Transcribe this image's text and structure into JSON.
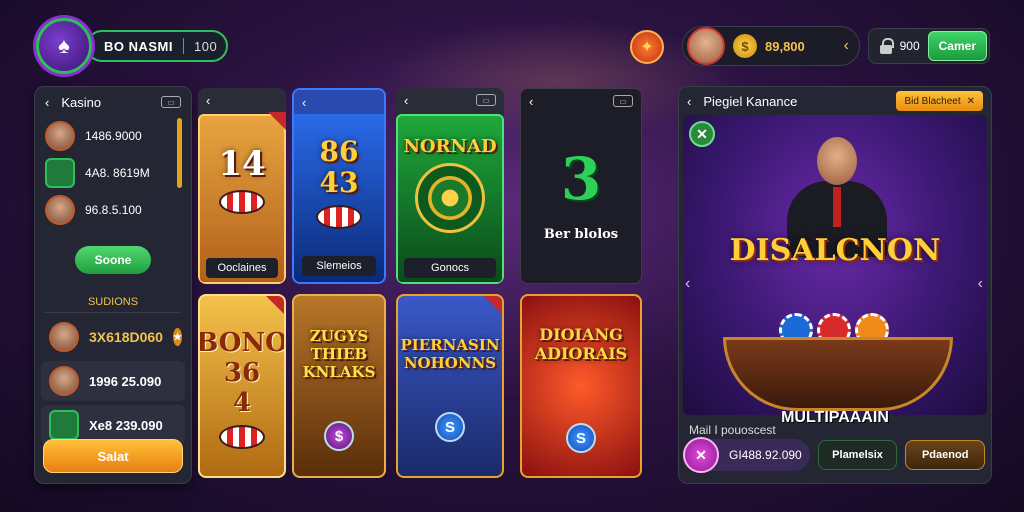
{
  "colors": {
    "accent_green": "#2fbf5a",
    "accent_gold": "#f3c24c",
    "accent_orange": "#e97e10",
    "panel_bg": "#242633"
  },
  "header": {
    "logo_icon": "casino-logo-icon",
    "brand": "BO NASMI",
    "brand_amount": "100",
    "user_balance": "89,800",
    "right_amount": "900",
    "right_button": "Camer"
  },
  "left_panel": {
    "title": "Kasino",
    "rows": [
      {
        "text": "1486.9000"
      },
      {
        "text": "4A8. 8619M"
      },
      {
        "text": "96.8.5.100"
      }
    ],
    "green_button": "Soone",
    "section_title": "SUDIONS",
    "rows2": [
      {
        "text": "3X618D060"
      },
      {
        "text": "1996 25.090"
      },
      {
        "text": "Xe8 239.090"
      }
    ],
    "orange_button": "Salat"
  },
  "cards": [
    {
      "big": "14",
      "caption": "Ooclaines"
    },
    {
      "big": "86\n43",
      "caption": "Slemeios"
    },
    {
      "big": "NORNAD",
      "caption": "Gonocs"
    },
    {
      "big": "3",
      "caption": "Ber blolos"
    },
    {
      "big": "BONO\n36\n4",
      "caption": ""
    },
    {
      "big": "ZUGYS\nTHIEB\nKNLAKS",
      "caption": ""
    },
    {
      "big": "PIERNASIN\nNOHONNS",
      "caption": ""
    },
    {
      "big": "DIOIANG\nADIORAIS",
      "caption": ""
    }
  ],
  "right_panel": {
    "title": "Piegiel Kanance",
    "tag": "Bid Blacheet",
    "art_title": "DISALCNON",
    "art_subtitle": "MULTIPAAAIN",
    "footer_title": "Mail I pouoscest",
    "footer_amount": "GI488.92.090",
    "footer_green": "Plamelsix",
    "footer_brown": "Pdaenod"
  }
}
